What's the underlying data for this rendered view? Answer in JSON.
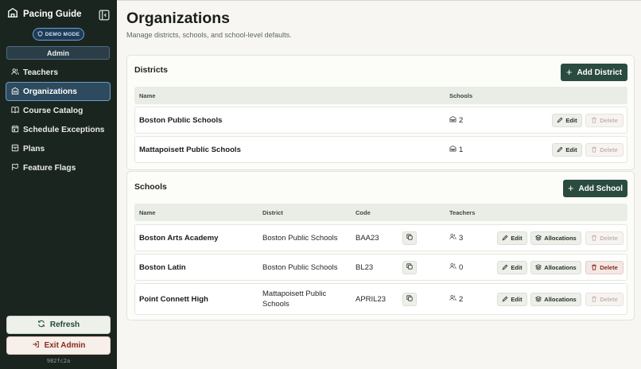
{
  "sidebar": {
    "brand": "Pacing Guide",
    "demo_badge": "DEMO MODE",
    "admin_badge": "Admin",
    "items": [
      {
        "label": "Teachers",
        "icon": "users-icon"
      },
      {
        "label": "Organizations",
        "icon": "building-icon",
        "active": true
      },
      {
        "label": "Course Catalog",
        "icon": "book-icon"
      },
      {
        "label": "Schedule Exceptions",
        "icon": "calendar-icon"
      },
      {
        "label": "Plans",
        "icon": "archive-icon"
      },
      {
        "label": "Feature Flags",
        "icon": "flag-icon"
      }
    ],
    "refresh_label": "Refresh",
    "exit_label": "Exit Admin",
    "version": "982fc2a"
  },
  "page": {
    "title": "Organizations",
    "subtitle": "Manage districts, schools, and school-level defaults."
  },
  "districts": {
    "title": "Districts",
    "add_label": "Add District",
    "columns": {
      "name": "Name",
      "schools": "Schools"
    },
    "rows": [
      {
        "name": "Boston Public Schools",
        "schools": "2"
      },
      {
        "name": "Mattapoisett Public Schools",
        "schools": "1"
      }
    ]
  },
  "schools": {
    "title": "Schools",
    "add_label": "Add School",
    "columns": {
      "name": "Name",
      "district": "District",
      "code": "Code",
      "teachers": "Teachers"
    },
    "rows": [
      {
        "name": "Boston Arts Academy",
        "district": "Boston Public Schools",
        "code": "BAA23",
        "teachers": "3",
        "delete_enabled": false
      },
      {
        "name": "Boston Latin",
        "district": "Boston Public Schools",
        "code": "BL23",
        "teachers": "0",
        "delete_enabled": true
      },
      {
        "name": "Point Connett High",
        "district_line1": "Mattapoisett Public",
        "district_line2": "Schools",
        "code": "APRIL23",
        "teachers": "2",
        "delete_enabled": false
      }
    ]
  },
  "actions": {
    "edit": "Edit",
    "delete": "Delete",
    "allocations": "Allocations"
  },
  "colors": {
    "sidebar_bg": "#1b2520",
    "primary": "#2a4b40",
    "active_border": "#6a9cc8",
    "danger": "#8a2a1e"
  }
}
